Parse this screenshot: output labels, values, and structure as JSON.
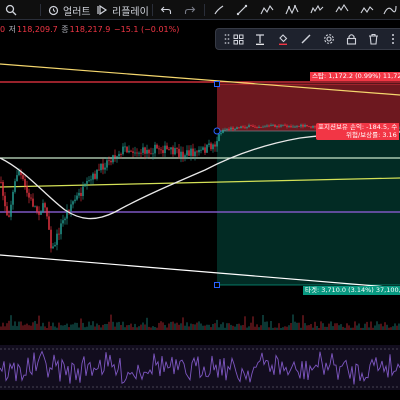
{
  "toolbar": {
    "search_icon": "magnifier-icon",
    "alert_label": "얼러트",
    "replay_label": "리플레이"
  },
  "ohlc": {
    "open_value": "0",
    "low_label": "저",
    "low_value": "118,209.7",
    "close_label": "종",
    "close_value": "118,217.9",
    "change": "−15.1 (−0.01%)"
  },
  "position": {
    "stop_label": "스탑: 1,172.2 (0.99%) 11,722",
    "pnl_label": "포지션보유 손익: -184.5, 수",
    "rr_label": "위험/보상률: 3.16",
    "target_label": "타겟: 3,710.0 (3.14%) 37,100,"
  },
  "colors": {
    "background": "#000000",
    "up": "#26a69a",
    "down": "#f23645",
    "stop_zone": "#f23645",
    "target_zone": "#089981",
    "accent": "#2962ff",
    "rsi_line": "#7e57c2"
  }
}
